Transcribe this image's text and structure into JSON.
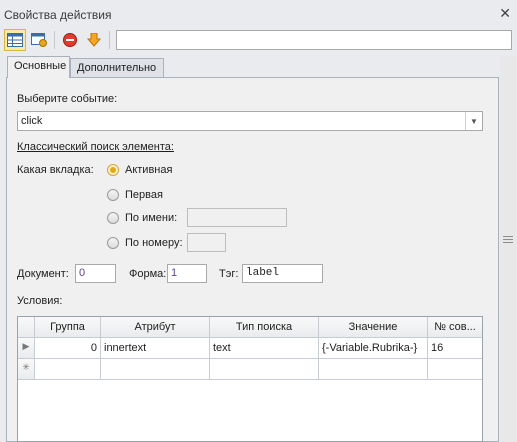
{
  "window": {
    "title": "Свойства действия",
    "close": "✕"
  },
  "toolbar": {
    "input_value": ""
  },
  "tabs": [
    {
      "label": "Основные",
      "selected": true
    },
    {
      "label": "Дополнительно",
      "selected": false
    }
  ],
  "event": {
    "label": "Выберите событие:",
    "value": "click"
  },
  "classic": {
    "heading": "Классический поиск элемента:",
    "tab_question": "Какая вкладка:",
    "options": [
      {
        "label": "Активная",
        "checked": true
      },
      {
        "label": "Первая",
        "checked": false
      },
      {
        "label": "По имени:",
        "checked": false
      },
      {
        "label": "По номеру:",
        "checked": false
      }
    ],
    "by_name_value": "",
    "by_number_value": ""
  },
  "fields": {
    "document_label": "Документ:",
    "document_value": "0",
    "form_label": "Форма:",
    "form_value": "1",
    "tag_label": "Тэг:",
    "tag_value": "label"
  },
  "conditions": {
    "label": "Условия:",
    "columns": [
      "Группа",
      "Атрибут",
      "Тип поиска",
      "Значение",
      "№ сов..."
    ],
    "rows": [
      {
        "indicator": "▶",
        "group": "0",
        "attribute": "innertext",
        "search_type": "text",
        "value": "{-Variable.Rubrika-}",
        "match_no": "16"
      },
      {
        "indicator": "✳",
        "group": "",
        "attribute": "",
        "search_type": "",
        "value": "",
        "match_no": ""
      }
    ]
  },
  "colors": {
    "accent": "#e6a818",
    "border": "#a9a9a9",
    "number_text": "#5b3fa0"
  }
}
